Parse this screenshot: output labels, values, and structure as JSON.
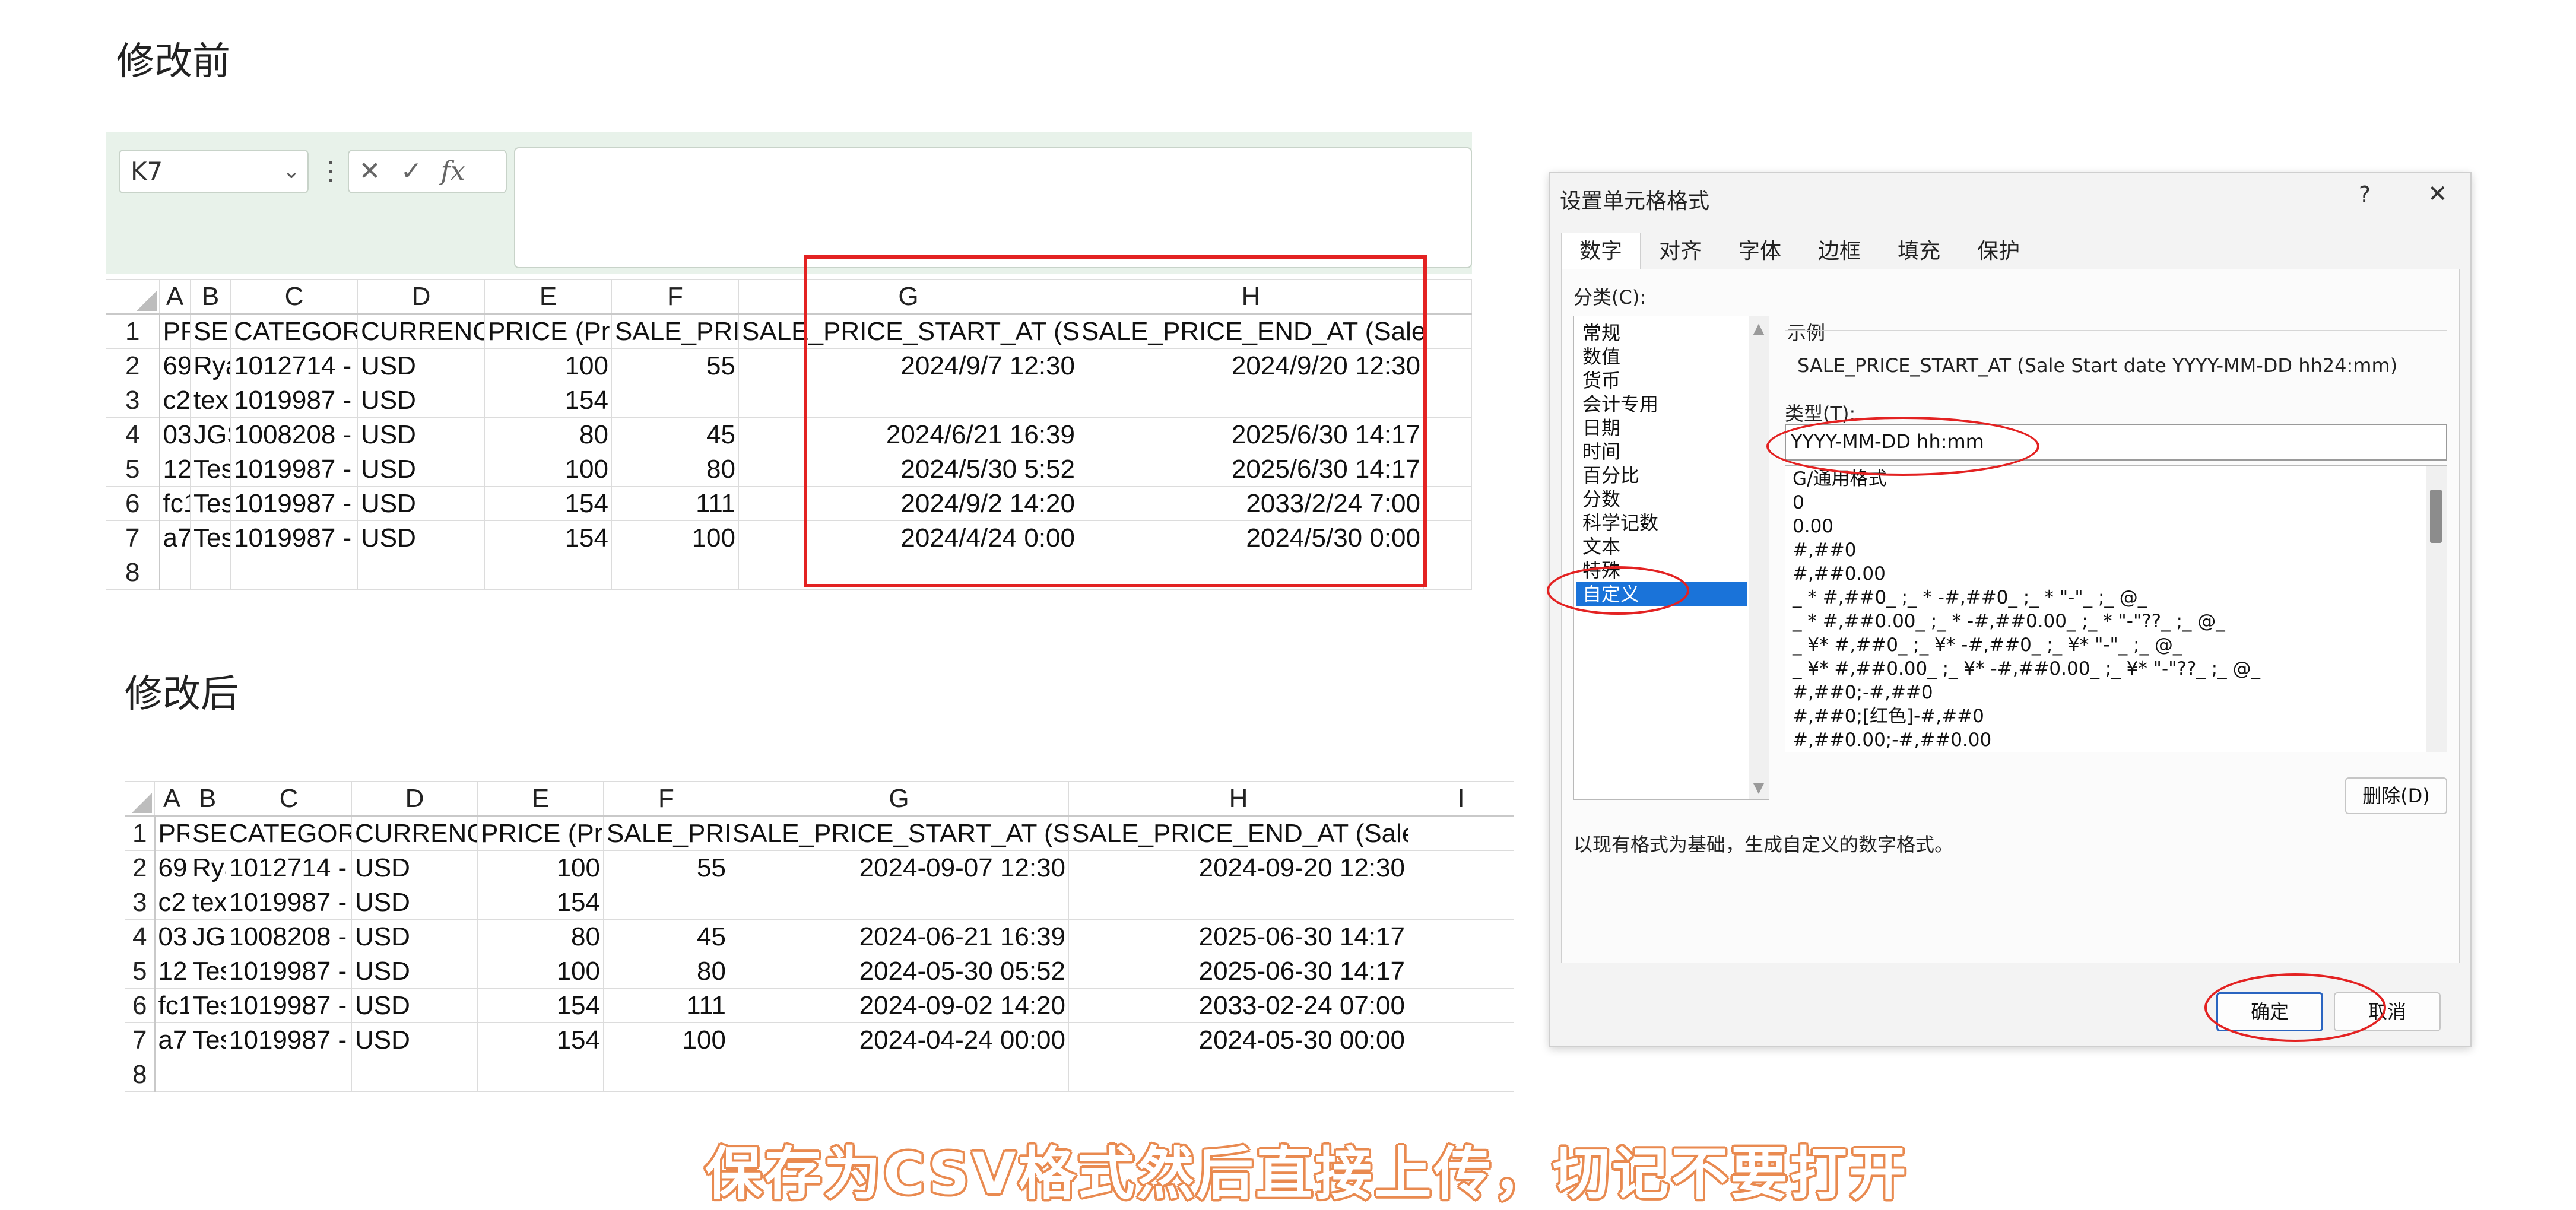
{
  "before_label": "修改前",
  "after_label": "修改后",
  "formula_bar": {
    "name_box": "K7",
    "fx": "fx",
    "cancel": "✕",
    "confirm": "✓",
    "dots": "⋮"
  },
  "columns_before": [
    "A",
    "B",
    "C",
    "D",
    "E",
    "F",
    "G",
    "H"
  ],
  "columns_after": [
    "A",
    "B",
    "C",
    "D",
    "E",
    "F",
    "G",
    "H",
    "I"
  ],
  "header_row": [
    "PR",
    "SEL",
    "CATEGORY",
    "CURRENCY",
    "PRICE (Pric",
    "SALE_PRIC",
    "SALE_PRICE_START_AT (Sale S",
    "SALE_PRICE_END_AT (Sale End d"
  ],
  "header_row_after": [
    "PR",
    "SEL",
    "CATEGORY",
    "CURRENCY",
    "PRICE (Pric",
    "SALE_PRIC",
    "SALE_PRICE_START_AT (Sale S",
    "SALE_PRICE_END_AT (Sale End date YY",
    ""
  ],
  "rows_before": [
    [
      "69",
      "Rya",
      "1012714 -",
      "USD",
      "100",
      "55",
      "2024/9/7 12:30",
      "2024/9/20 12:30"
    ],
    [
      "c2",
      "tex",
      "1019987 -",
      "USD",
      "154",
      "",
      "",
      ""
    ],
    [
      "03",
      "JGS",
      "1008208 -",
      "USD",
      "80",
      "45",
      "2024/6/21 16:39",
      "2025/6/30 14:17"
    ],
    [
      "12",
      "Tes",
      "1019987 -",
      "USD",
      "100",
      "80",
      "2024/5/30 5:52",
      "2025/6/30 14:17"
    ],
    [
      "fc1",
      "Tes",
      "1019987 -",
      "USD",
      "154",
      "111",
      "2024/9/2 14:20",
      "2033/2/24 7:00"
    ],
    [
      "a7",
      "Tes",
      "1019987 -",
      "USD",
      "154",
      "100",
      "2024/4/24 0:00",
      "2024/5/30 0:00"
    ]
  ],
  "rows_after": [
    [
      "69",
      "Rya",
      "1012714 -",
      "USD",
      "100",
      "55",
      "2024-09-07 12:30",
      "2024-09-20 12:30",
      ""
    ],
    [
      "c2",
      "tex",
      "1019987 -",
      "USD",
      "154",
      "",
      "",
      "",
      ""
    ],
    [
      "03",
      "JGS",
      "1008208 -",
      "USD",
      "80",
      "45",
      "2024-06-21 16:39",
      "2025-06-30 14:17",
      ""
    ],
    [
      "12",
      "Tes",
      "1019987 -",
      "USD",
      "100",
      "80",
      "2024-05-30 05:52",
      "2025-06-30 14:17",
      ""
    ],
    [
      "fc1",
      "Tes",
      "1019987 -",
      "USD",
      "154",
      "111",
      "2024-09-02 14:20",
      "2033-02-24 07:00",
      ""
    ],
    [
      "a7",
      "Tes",
      "1019987 -",
      "USD",
      "154",
      "100",
      "2024-04-24 00:00",
      "2024-05-30 00:00",
      ""
    ]
  ],
  "row_numbers": [
    "1",
    "2",
    "3",
    "4",
    "5",
    "6",
    "7",
    "8"
  ],
  "dialog": {
    "title": "设置单元格格式",
    "help": "?",
    "close": "✕",
    "tabs": [
      "数字",
      "对齐",
      "字体",
      "边框",
      "填充",
      "保护"
    ],
    "category_label": "分类(C):",
    "categories": [
      "常规",
      "数值",
      "货币",
      "会计专用",
      "日期",
      "时间",
      "百分比",
      "分数",
      "科学记数",
      "文本",
      "特殊",
      "自定义"
    ],
    "selected_category": "自定义",
    "sample_label": "示例",
    "sample_value": "SALE_PRICE_START_AT (Sale Start date YYYY-MM-DD hh24:mm)",
    "type_label": "类型(T):",
    "type_value": "YYYY-MM-DD hh:mm",
    "formats": [
      "G/通用格式",
      "0",
      "0.00",
      "#,##0",
      "#,##0.00",
      "_ * #,##0_ ;_ * -#,##0_ ;_ * \"-\"_ ;_ @_",
      "_ * #,##0.00_ ;_ * -#,##0.00_ ;_ * \"-\"??_ ;_ @_",
      "_ ¥* #,##0_ ;_ ¥* -#,##0_ ;_ ¥* \"-\"_ ;_ @_",
      "_ ¥* #,##0.00_ ;_ ¥* -#,##0.00_ ;_ ¥* \"-\"??_ ;_ @_",
      "#,##0;-#,##0",
      "#,##0;[红色]-#,##0",
      "#,##0.00;-#,##0.00"
    ],
    "delete_button": "删除(D)",
    "description": "以现有格式为基础，生成自定义的数字格式。",
    "ok_button": "确定",
    "cancel_button": "取消"
  },
  "caption": "保存为CSV格式然后直接上传，切记不要打开",
  "colors": {
    "annotation_red": "#e32222",
    "selected_blue": "#1a73d9",
    "excel_green": "#1e7145",
    "caption_orange": "#e98a50"
  }
}
